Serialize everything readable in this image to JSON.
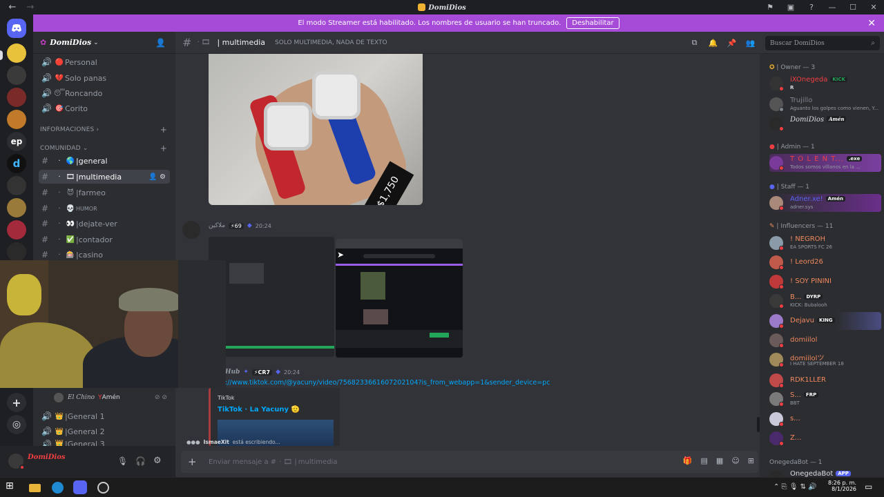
{
  "window": {
    "title": "DomiDios"
  },
  "banner": {
    "text": "El modo Streamer está habilitado. Los nombres de usuario se han truncado.",
    "button": "Deshabilitar"
  },
  "server": {
    "name": "DomiDios"
  },
  "channels_top": [
    {
      "emoji": "🔴",
      "label": "Personal"
    },
    {
      "emoji": "💔",
      "label": "Solo panas"
    },
    {
      "emoji": "😴",
      "label": "Roncando"
    },
    {
      "emoji": "🎯",
      "label": "Corito"
    }
  ],
  "categories": {
    "info": "INFORMACIONES",
    "community": "COMUNIDAD"
  },
  "channels_community": [
    {
      "emoji": "🌎",
      "label": "general",
      "state": "bright"
    },
    {
      "emoji": "🎞",
      "label": "multimedia",
      "state": "active"
    },
    {
      "emoji": "😈",
      "label": "farmeo",
      "state": ""
    },
    {
      "emoji": "💀",
      "label": "HUMOR",
      "state": ""
    },
    {
      "emoji": "👀",
      "label": "dejate-ver",
      "state": ""
    },
    {
      "emoji": "✅",
      "label": "contador",
      "state": ""
    },
    {
      "emoji": "🎰",
      "label": "casino",
      "state": ""
    }
  ],
  "voice_user": {
    "name": "El Chino",
    "badge": "Amén"
  },
  "channels_voice": [
    {
      "emoji": "👑",
      "label": "General 1"
    },
    {
      "emoji": "👑",
      "label": "General 2"
    },
    {
      "emoji": "👑",
      "label": "General 3"
    }
  ],
  "user_panel": {
    "name": "DomiDios"
  },
  "channel_header": {
    "name": "multimedia",
    "topic": "SOLO MULTIMEDIA, NADA DE TEXTO"
  },
  "search": {
    "placeholder": "Buscar DomiDios"
  },
  "messages": [
    {
      "author": "ملاكين",
      "tag": "69",
      "time": "20:24"
    },
    {
      "author": "Hub",
      "tag": "CR7",
      "time": "20:24",
      "link": "://www.tiktok.com/@yacuny/video/7568233661607202104?is_from_webapp=1&sender_device=pc",
      "embed_provider": "TikTok",
      "embed_title": "TikTok · La Yacuny 🫡"
    }
  ],
  "price_tag": "$1,750",
  "typing": {
    "user": "IsmaeXit",
    "text": "está escribiendo..."
  },
  "input": {
    "placeholder": "Enviar mensaje a #",
    "channel": "multimedia"
  },
  "members": {
    "roles": [
      {
        "label": "| Owner — 3"
      },
      {
        "label": "| Admin — 1"
      },
      {
        "label": "| Staff — 1"
      },
      {
        "label": "| Influencers — 11"
      },
      {
        "label": "OnegedaBot — 1"
      }
    ],
    "list": [
      {
        "name": "iXOnegeda",
        "tag": "KICK",
        "sub": "R",
        "color": "#f23f43"
      },
      {
        "name": "Trujillo",
        "tag": "",
        "sub": "Aguanto los golpes como vienen, Y...",
        "color": "#80848e"
      },
      {
        "name": "DomiDios",
        "tag": "Amén",
        "sub": "",
        "color": "#dbdee1"
      },
      {
        "name": "T O L E N T...",
        "tag": ".exe",
        "sub": "Todos somos villanos en la ...",
        "color": "#f23f43"
      },
      {
        "name": "Adner.xe!",
        "tag": "Amén",
        "sub": "adner.sys",
        "color": "#5865f2"
      },
      {
        "name": "! NEGROH",
        "tag": "",
        "sub": "EA SPORTS FC 26",
        "color": "#f2895e"
      },
      {
        "name": "! Leord26",
        "tag": "",
        "sub": "",
        "color": "#f2895e"
      },
      {
        "name": "! SOY PININI",
        "tag": "",
        "sub": "",
        "color": "#f2895e"
      },
      {
        "name": "B...",
        "tag": "DYRP",
        "sub": "KICK: Bubalooh",
        "color": "#f2895e"
      },
      {
        "name": "Dejavu",
        "tag": "KING",
        "sub": "",
        "color": "#f2895e"
      },
      {
        "name": "domiilol",
        "tag": "",
        "sub": "",
        "color": "#f2895e"
      },
      {
        "name": "domiilolツ",
        "tag": "",
        "sub": "I HATE SEPTEMBER 18",
        "color": "#f2895e"
      },
      {
        "name": "RDK1LLER",
        "tag": "",
        "sub": "",
        "color": "#f2895e"
      },
      {
        "name": "S...",
        "tag": "FRP",
        "sub": "BBT",
        "color": "#f2895e"
      },
      {
        "name": "s...",
        "tag": "",
        "sub": "",
        "color": "#f2895e"
      },
      {
        "name": "Z...",
        "tag": "",
        "sub": "",
        "color": "#f2895e"
      },
      {
        "name": "OnegedaBot",
        "tag": "APP",
        "sub": "",
        "color": "#dbdee1"
      }
    ]
  },
  "taskbar": {
    "time": "8:26 p. m.",
    "date": "8/1/2026"
  },
  "server_rail": {
    "dm": "discord-icon",
    "ep": "ep"
  }
}
